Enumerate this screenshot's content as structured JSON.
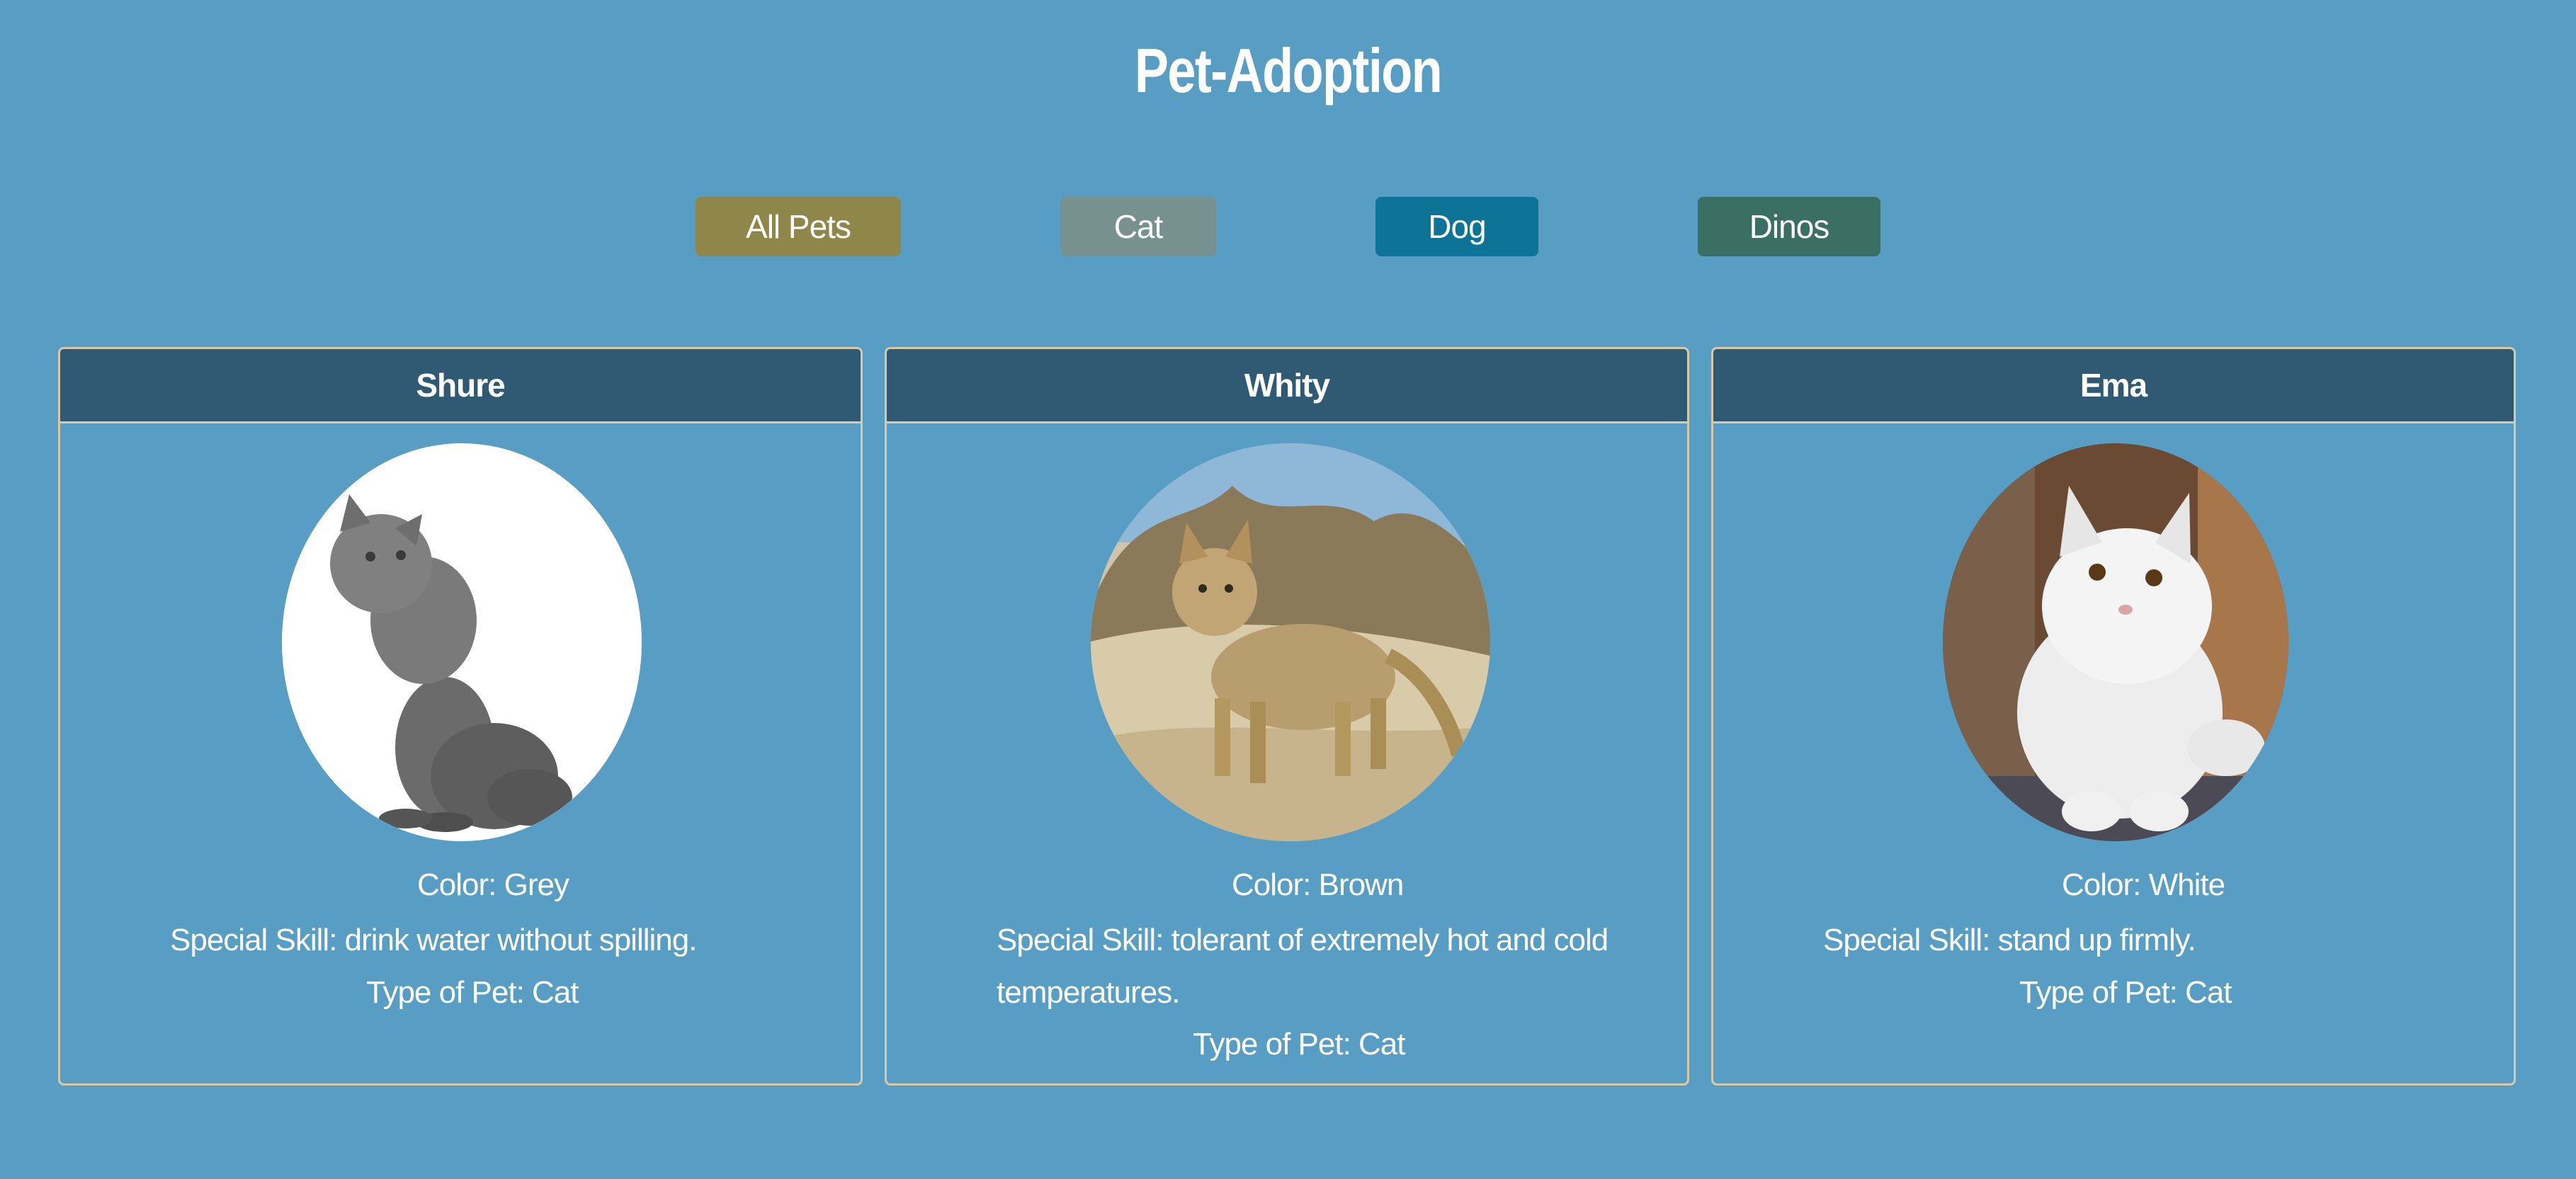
{
  "page": {
    "title": "Pet-Adoption"
  },
  "filters": [
    {
      "label": "All Pets",
      "color": "#8f8749"
    },
    {
      "label": "Cat",
      "color": "#76918f"
    },
    {
      "label": "Dog",
      "color": "#0e7497"
    },
    {
      "label": "Dinos",
      "color": "#3c6f64"
    }
  ],
  "pets": [
    {
      "name": "Shure",
      "color_label": "Color: Grey",
      "skill_line1": "Special Skill: drink water without spilling.",
      "skill_line2": "",
      "type_label": "Type of Pet: Cat",
      "photo": "grey-cat-photo"
    },
    {
      "name": "Whity",
      "color_label": "Color: Brown",
      "skill_line1": "Special Skill: tolerant of extremely hot and cold",
      "skill_line2": "temperatures.",
      "type_label": "Type of Pet: Cat",
      "photo": "sand-cat-photo"
    },
    {
      "name": "Ema",
      "color_label": "Color: White",
      "skill_line1": "Special Skill: stand up firmly.",
      "skill_line2": "",
      "type_label": "Type of Pet: Cat",
      "photo": "white-persian-cat-photo"
    }
  ],
  "theme": {
    "background": "#589dc3",
    "card_header": "#305a73",
    "card_border": "#d9c9a7"
  }
}
